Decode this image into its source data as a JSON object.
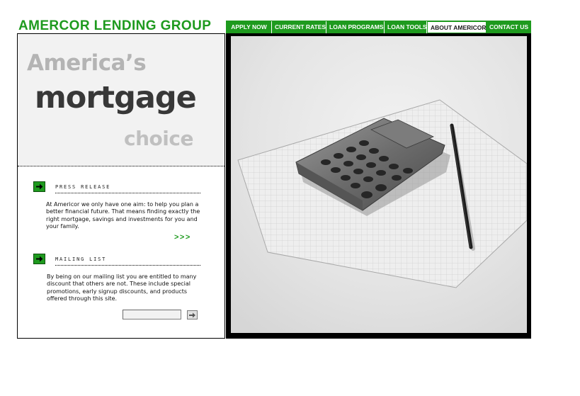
{
  "brand": {
    "name": "AMERCOR LENDING GROUP",
    "color": "#1e9a1e"
  },
  "nav": {
    "items": [
      {
        "label": "APPLY NOW"
      },
      {
        "label": "CURRENT RATES"
      },
      {
        "label": "LOAN PROGRAMS"
      },
      {
        "label": "LOAN TOOLS"
      },
      {
        "label": "ABOUT AMERICOR",
        "active": true
      },
      {
        "label": "CONTACT US"
      }
    ]
  },
  "hero": {
    "line1": "America’s",
    "line2": "mortgage",
    "line3": "choice"
  },
  "press_release": {
    "title": "PRESS RELEASE",
    "body": "At Americor we only have one aim: to help you plan a better financial future. That means finding exactly the right mortgage, savings and investments for you and your family.",
    "more_label": ">>>"
  },
  "mailing_list": {
    "title": "MAILING LIST",
    "body": "By being on our mailing list you are entitled to many discount that others are not. These include special promotions, early signup discounts, and products offered through this site.",
    "input_value": ""
  },
  "icons": {
    "section_arrow": "arrow-right-icon",
    "submit": "arrow-right-icon"
  },
  "colors": {
    "accent": "#1e9a1e",
    "hero_dark": "#383838",
    "hero_light": "#b4b4b4"
  }
}
